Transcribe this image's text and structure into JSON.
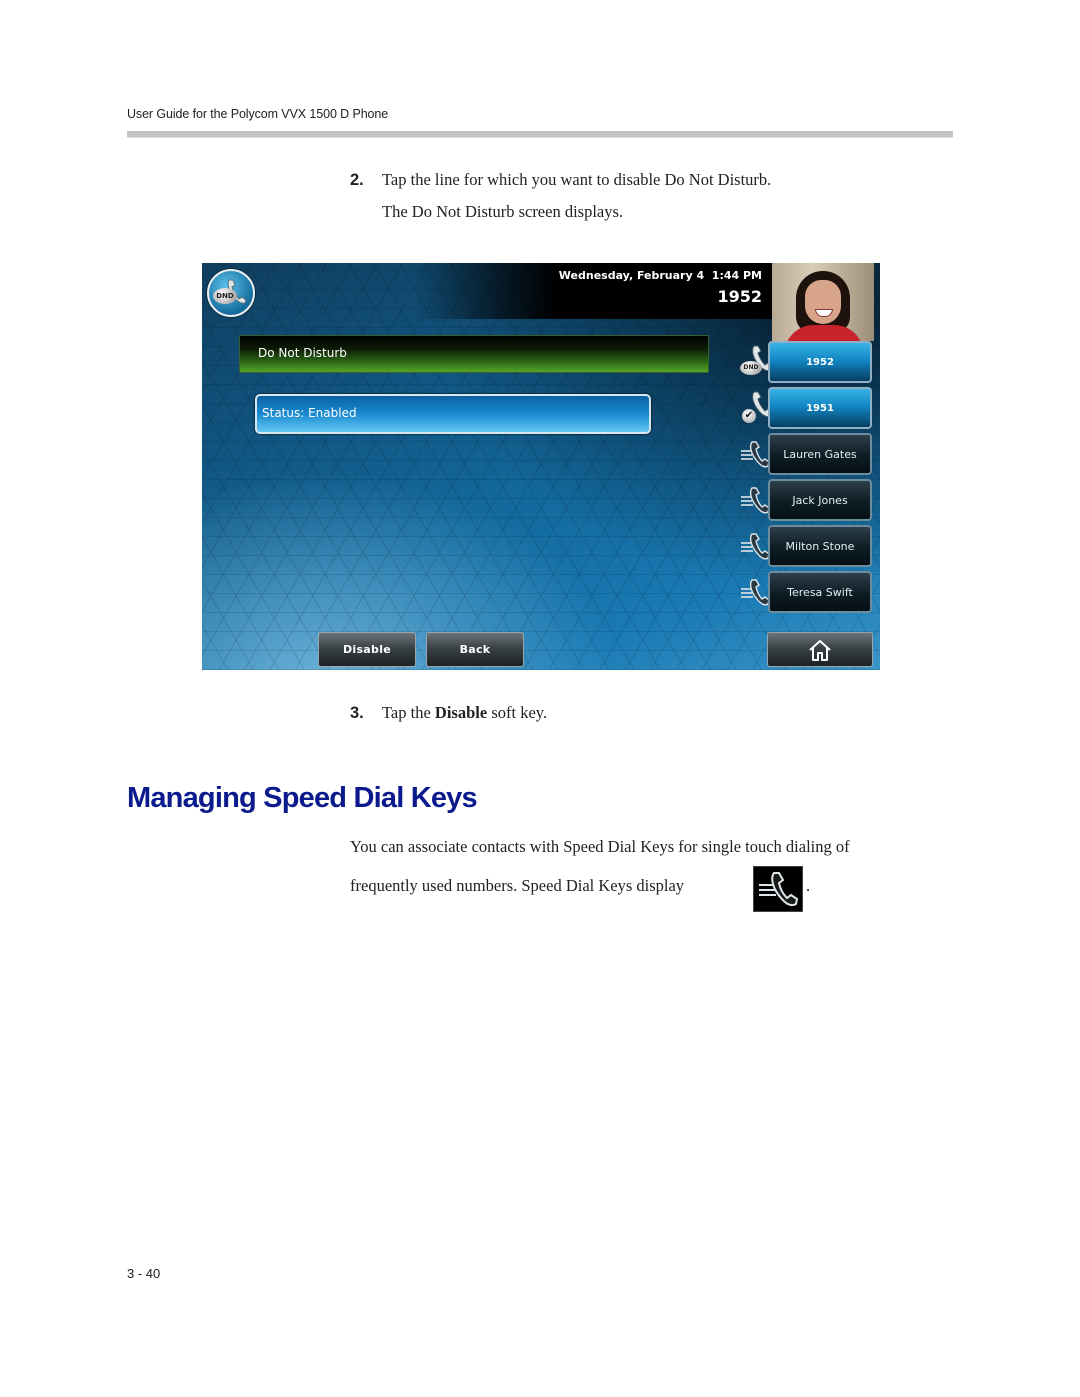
{
  "document": {
    "running_header": "User Guide for the Polycom VVX 1500 D Phone",
    "page_number": "3 - 40"
  },
  "steps": [
    {
      "number": "2.",
      "text": "Tap the line for which you want to disable Do Not Disturb.",
      "continuation": "The Do Not Disturb screen displays."
    },
    {
      "number": "3.",
      "text_before": "Tap the ",
      "bold": "Disable",
      "text_after": " soft key."
    }
  ],
  "phone_screen": {
    "datetime": "Wednesday, February 4  1:44 PM",
    "line_number": "1952",
    "dnd_badge_label": "DND",
    "screen_title": "Do Not Disturb",
    "status_item": "Status: Enabled",
    "line_keys": [
      {
        "label": "1952",
        "type": "line",
        "indicator": "DND"
      },
      {
        "label": "1951",
        "type": "line",
        "indicator": "check"
      },
      {
        "label": "Lauren Gates",
        "type": "speed-dial"
      },
      {
        "label": "Jack Jones",
        "type": "speed-dial"
      },
      {
        "label": "Milton Stone",
        "type": "speed-dial"
      },
      {
        "label": "Teresa Swift",
        "type": "speed-dial"
      }
    ],
    "soft_keys": [
      {
        "label": "Disable"
      },
      {
        "label": "Back"
      }
    ],
    "home_key_icon": "home-icon",
    "colors": {
      "title_bar_green": "#53a52a",
      "status_blue": "#1a8ad0",
      "background_blue": "#136a9e"
    }
  },
  "section": {
    "title": "Managing Speed Dial Keys",
    "paragraph_line1": "You can associate contacts with Speed Dial Keys for single touch dialing of",
    "paragraph_line2": "frequently used numbers. Speed Dial Keys display",
    "paragraph_end": ".",
    "inline_icon": "speed-dial-icon",
    "title_color": "#0b1a8c"
  }
}
